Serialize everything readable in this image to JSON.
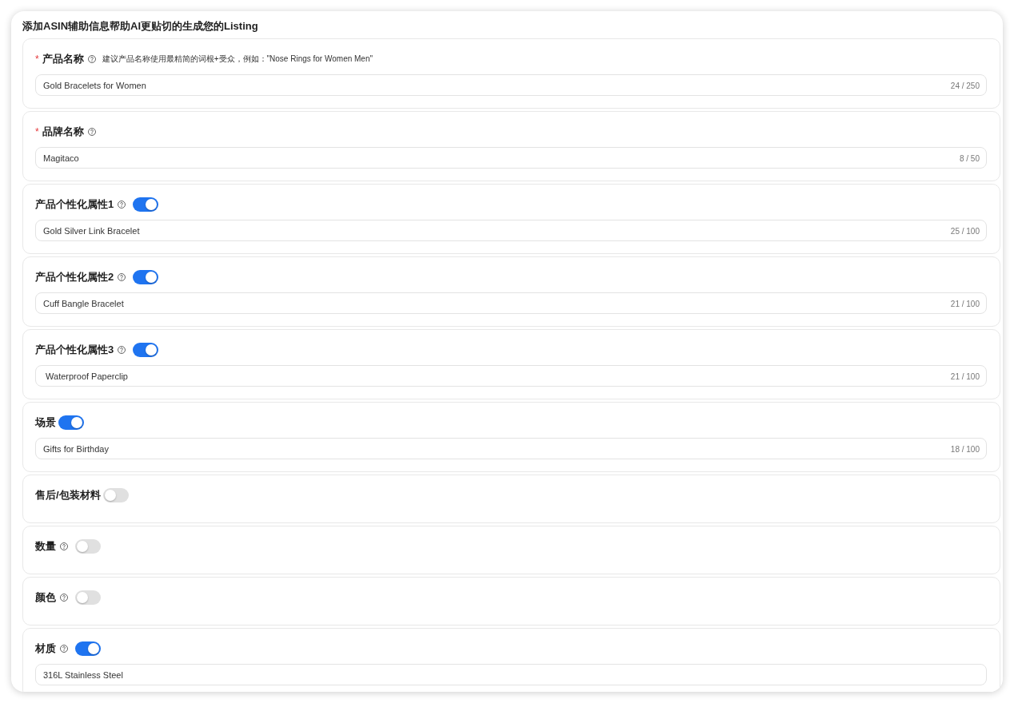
{
  "panel": {
    "title": "添加ASIN辅助信息帮助AI更贴切的生成您的Listing"
  },
  "fields": [
    {
      "required_mark": "*",
      "label": "产品名称",
      "help": true,
      "hint": "建议产品名称使用最精简的词根+受众，例如：\"Nose Rings for Women Men\"",
      "value": "Gold Bracelets for Women",
      "counter": "24 / 250"
    },
    {
      "required_mark": "*",
      "label": "品牌名称",
      "help": true,
      "value": "Magitaco",
      "counter": "8 / 50"
    },
    {
      "label": "产品个性化属性1",
      "help": true,
      "switch": {
        "on": true
      },
      "value": "Gold Silver Link Bracelet",
      "counter": "25 / 100"
    },
    {
      "label": "产品个性化属性2",
      "help": true,
      "switch": {
        "on": true
      },
      "value": "Cuff Bangle Bracelet",
      "counter": "21 / 100"
    },
    {
      "label": "产品个性化属性3",
      "help": true,
      "switch": {
        "on": true
      },
      "value": " Waterproof Paperclip",
      "counter": "21 / 100"
    },
    {
      "label": "场景",
      "help": false,
      "switch": {
        "on": true
      },
      "value": "Gifts for Birthday",
      "counter": "18 / 100"
    },
    {
      "label": "售后/包装材料",
      "help": false,
      "switch": {
        "on": false
      }
    },
    {
      "label": "数量",
      "help": true,
      "switch": {
        "on": false
      }
    },
    {
      "label": "颜色",
      "help": true,
      "switch": {
        "on": false
      }
    },
    {
      "label": "材质",
      "help": true,
      "switch": {
        "on": true
      },
      "value": "316L Stainless Steel"
    }
  ]
}
